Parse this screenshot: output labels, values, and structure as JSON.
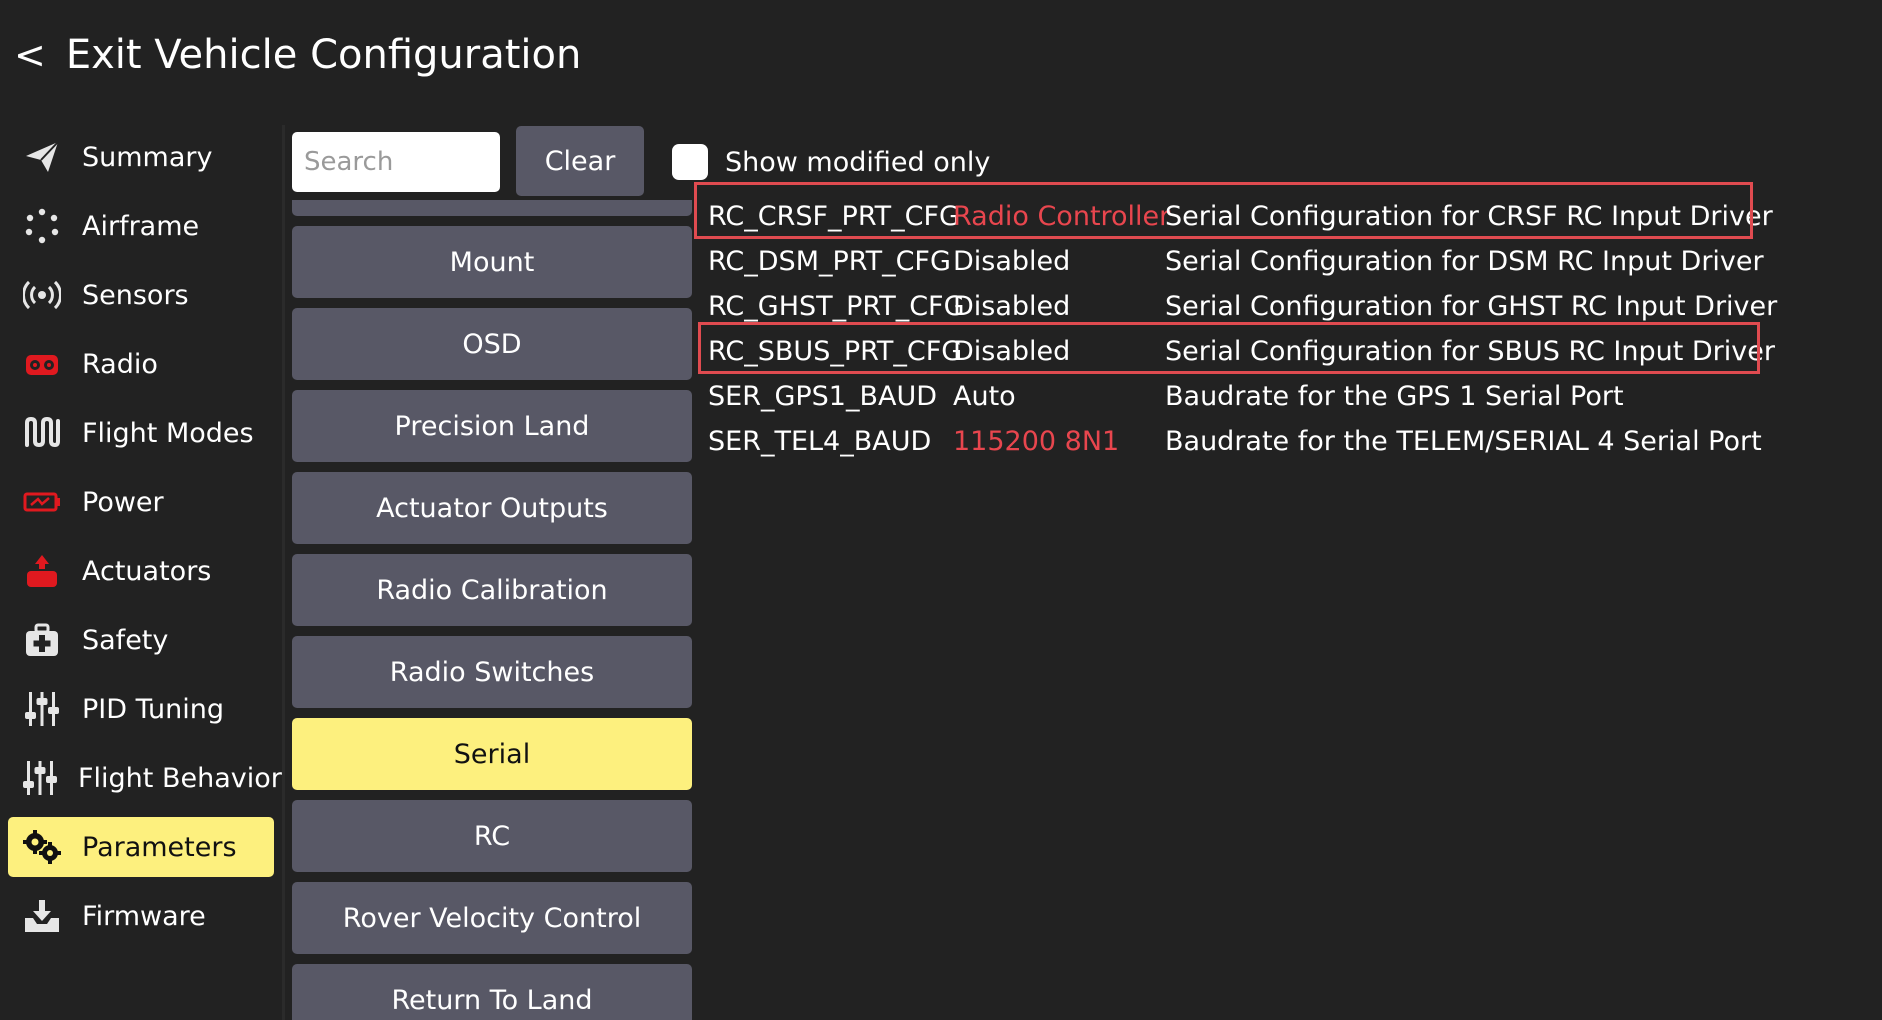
{
  "header": {
    "back_glyph": "<",
    "title": "Exit Vehicle Configuration"
  },
  "sidebar": {
    "items": [
      {
        "label": "Summary",
        "icon": "paper-plane-icon"
      },
      {
        "label": "Airframe",
        "icon": "airframe-icon"
      },
      {
        "label": "Sensors",
        "icon": "sensors-icon"
      },
      {
        "label": "Radio",
        "icon": "radio-icon"
      },
      {
        "label": "Flight Modes",
        "icon": "flight-modes-icon"
      },
      {
        "label": "Power",
        "icon": "battery-icon"
      },
      {
        "label": "Actuators",
        "icon": "actuators-icon"
      },
      {
        "label": "Safety",
        "icon": "first-aid-icon"
      },
      {
        "label": "PID Tuning",
        "icon": "sliders-icon"
      },
      {
        "label": "Flight Behavior",
        "icon": "sliders-icon"
      },
      {
        "label": "Parameters",
        "icon": "gears-icon"
      },
      {
        "label": "Firmware",
        "icon": "download-icon"
      }
    ],
    "active": "Parameters"
  },
  "search": {
    "placeholder": "Search",
    "value": ""
  },
  "clear_label": "Clear",
  "show_modified_label": "Show modified only",
  "groups": [
    "Mount",
    "OSD",
    "Precision Land",
    "Actuator Outputs",
    "Radio Calibration",
    "Radio Switches",
    "Serial",
    "RC",
    "Rover Velocity Control",
    "Return To Land"
  ],
  "active_group": "Serial",
  "params": [
    {
      "name": "RC_CRSF_PRT_CFG",
      "value": "Radio Controller",
      "modified": true,
      "description": "Serial Configuration for CRSF RC Input Driver",
      "highlighted": true
    },
    {
      "name": "RC_DSM_PRT_CFG",
      "value": "Disabled",
      "modified": false,
      "description": "Serial Configuration for DSM RC Input Driver",
      "highlighted": false
    },
    {
      "name": "RC_GHST_PRT_CFG",
      "value": "Disabled",
      "modified": false,
      "description": "Serial Configuration for GHST RC Input Driver",
      "highlighted": false
    },
    {
      "name": "RC_SBUS_PRT_CFG",
      "value": "Disabled",
      "modified": false,
      "description": "Serial Configuration for SBUS RC Input Driver",
      "highlighted": true
    },
    {
      "name": "SER_GPS1_BAUD",
      "value": "Auto",
      "modified": false,
      "description": "Baudrate for the GPS 1 Serial Port",
      "highlighted": false
    },
    {
      "name": "SER_TEL4_BAUD",
      "value": "115200 8N1",
      "modified": true,
      "description": "Baudrate for the TELEM/SERIAL 4 Serial Port",
      "highlighted": false
    }
  ],
  "colors": {
    "background": "#222222",
    "active_yellow": "#fdf07e",
    "button_gray": "#585866",
    "modified_red": "#e8464e",
    "highlight_red": "#e04b50",
    "icon_red": "#e0191f"
  }
}
